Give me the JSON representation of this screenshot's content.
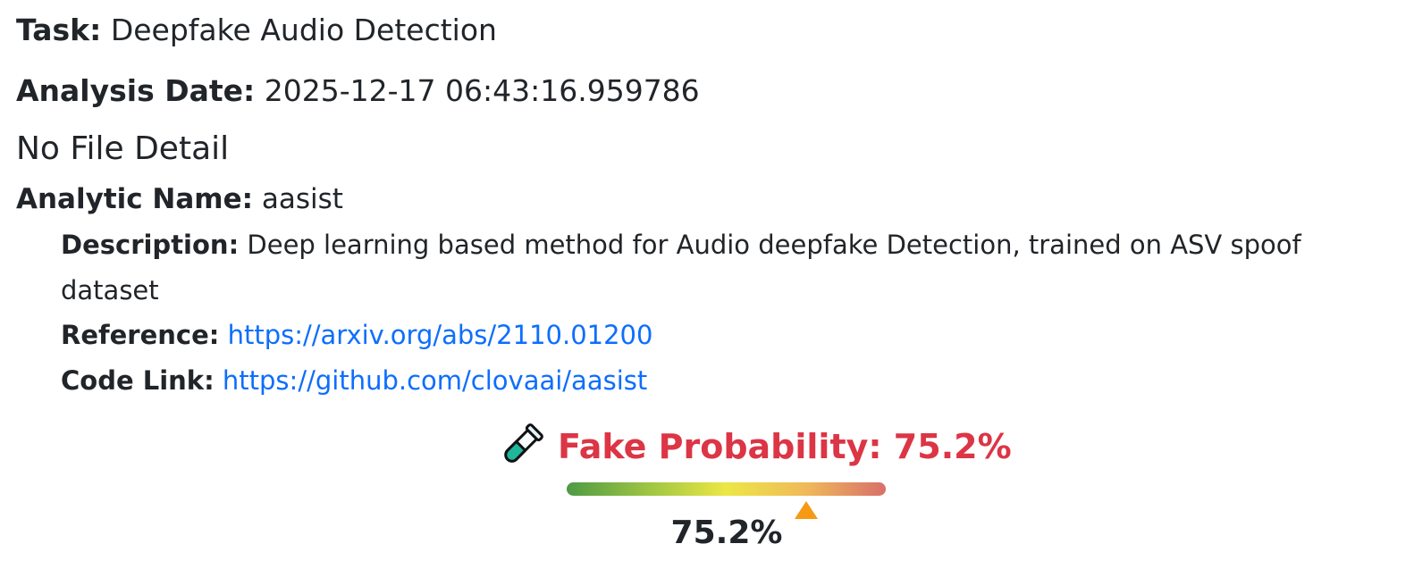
{
  "task": {
    "label": "Task:",
    "value": "Deepfake Audio Detection"
  },
  "analysis_date": {
    "label": "Analysis Date:",
    "value": "2025-12-17 06:43:16.959786"
  },
  "file_detail": "No File Detail",
  "analytic": {
    "name_label": "Analytic Name:",
    "name": "aasist",
    "description_label": "Description:",
    "description": "Deep learning based method for Audio deepfake Detection, trained on ASV spoof dataset",
    "reference_label": "Reference:",
    "reference_url": "https://arxiv.org/abs/2110.01200",
    "code_label": "Code Link:",
    "code_url": "https://github.com/clovaai/aasist"
  },
  "result": {
    "icon": "test-tube-icon",
    "title": "Fake Probability: 75.2%",
    "title_color": "#dc3545",
    "probability": 0.752,
    "value_text": "75.2%",
    "marker_color": "#f59a12",
    "gauge_colors": [
      "#4e9a45",
      "#9cc443",
      "#ece745",
      "#f0b95a",
      "#d86f6a"
    ]
  }
}
